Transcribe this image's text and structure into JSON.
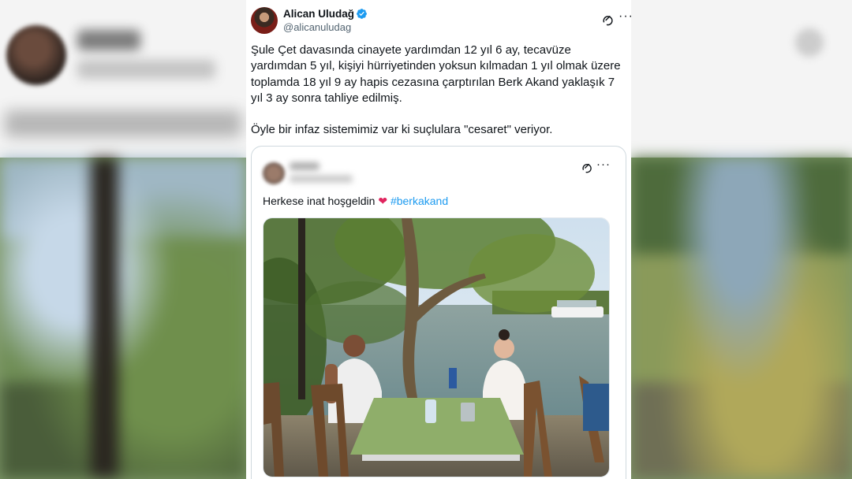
{
  "background_profile": {
    "name": "Herkip",
    "handle": "@herkipkod",
    "text": "Herkese inat hoşgeldin"
  },
  "tweet": {
    "author_name": "Alican Uludağ",
    "handle": "@alicanuludag",
    "verified": true,
    "paragraph1": "Şule Çet davasında cinayete yardımdan 12 yıl 6 ay, tecavüze yardımdan 5 yıl, kişiyi hürriyetinden yoksun kılmadan 1 yıl olmak üzere toplamda 18 yıl 9 ay hapis cezasına çarptırılan Berk Akand yaklaşık 7 yıl 3 ay sonra tahliye edilmiş.",
    "paragraph2": "Öyle bir infaz sistemimiz var ki suçlulara \"cesaret\" veriyor.",
    "more_label": "···"
  },
  "quoted_tweet": {
    "text": "Herkese inat hoşgeldin",
    "heart": "❤",
    "hashtag": "#berkakand",
    "more_label": "···"
  },
  "colors": {
    "accent": "#1d9bf0",
    "text": "#0f1419",
    "muted": "#536471",
    "heart": "#e0245e"
  },
  "icons": [
    "verified-badge-icon",
    "grok-icon",
    "more-icon",
    "heart-emoji"
  ]
}
